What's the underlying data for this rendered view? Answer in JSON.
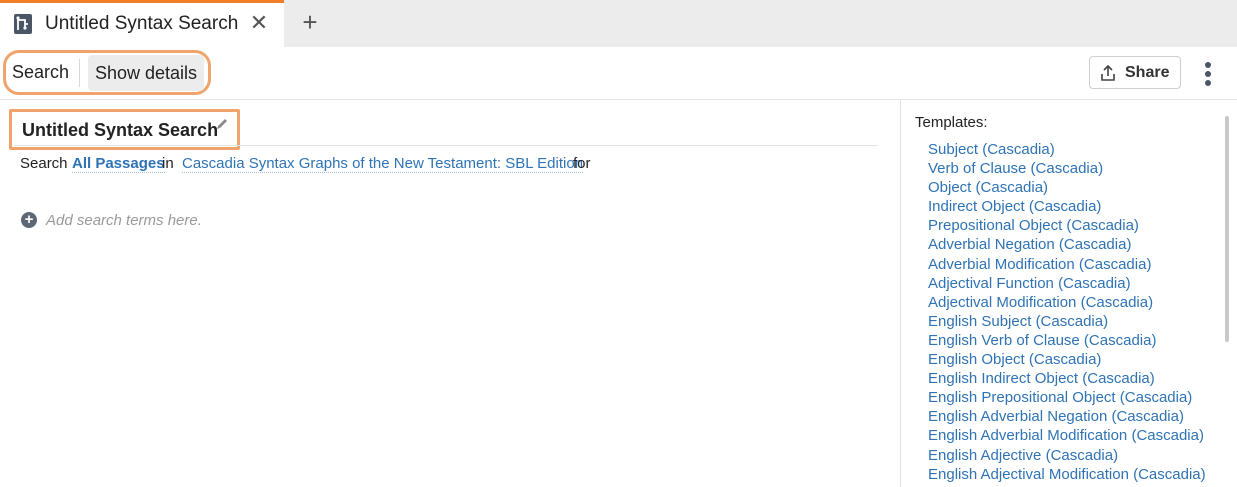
{
  "tab": {
    "title": "Untitled Syntax Search",
    "close_glyph": "✕",
    "new_tab_glyph": "+",
    "icon": "syntax-tree-icon"
  },
  "toolbar": {
    "search_label": "Search",
    "show_details_label": "Show details",
    "share_label": "Share",
    "share_icon": "upload-icon",
    "more_icon": "more-vertical-icon"
  },
  "main": {
    "title": "Untitled Syntax Search",
    "edit_icon": "pencil-icon",
    "search_prefix": "Search",
    "passages_link": "All Passages",
    "in_word": "in",
    "corpus_link": "Cascadia Syntax Graphs of the New Testament: SBL Edition",
    "for_word": "for",
    "add_terms_placeholder": "Add search terms here."
  },
  "templates": {
    "heading": "Templates:",
    "items": [
      "Subject (Cascadia)",
      "Verb of Clause (Cascadia)",
      "Object (Cascadia)",
      "Indirect Object (Cascadia)",
      "Prepositional Object (Cascadia)",
      "Adverbial Negation (Cascadia)",
      "Adverbial Modification (Cascadia)",
      "Adjectival Function (Cascadia)",
      "Adjectival Modification (Cascadia)",
      "English Subject (Cascadia)",
      "English Verb of Clause (Cascadia)",
      "English Object (Cascadia)",
      "English Indirect Object (Cascadia)",
      "English Prepositional Object (Cascadia)",
      "English Adverbial Negation (Cascadia)",
      "English Adverbial Modification (Cascadia)",
      "English Adjective (Cascadia)",
      "English Adjectival Modification (Cascadia)"
    ]
  },
  "colors": {
    "accent": "#f07e26",
    "highlight": "#f0a46b",
    "link": "#2f73b5"
  }
}
